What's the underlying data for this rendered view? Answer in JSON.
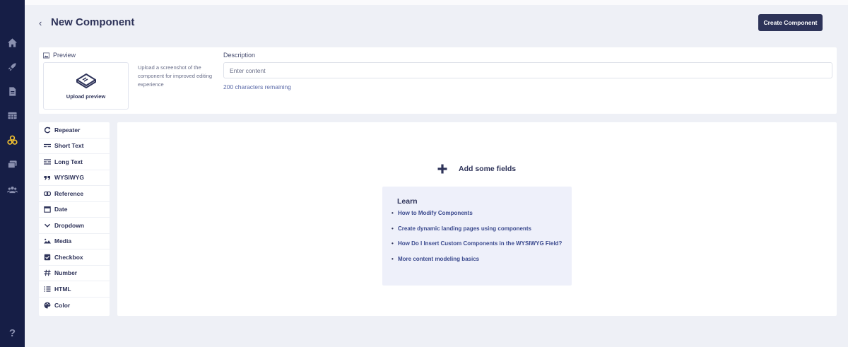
{
  "header": {
    "back_icon": "chevron-left-icon",
    "back_glyph": "‹",
    "title": "New Component",
    "create_label": "Create Component"
  },
  "rail": {
    "icons": [
      "home-icon",
      "rocket-icon",
      "document-icon",
      "table-icon",
      "components-icon",
      "media-icon",
      "users-icon",
      "help-icon"
    ],
    "active": "components-icon",
    "active_color": "#f3c230",
    "icon_color": "#8a90b0",
    "help_glyph": "?"
  },
  "preview": {
    "label": "Preview",
    "upload_label": "Upload preview",
    "help_text": "Upload a screenshot of the component for improved editing experience"
  },
  "description": {
    "label": "Description",
    "placeholder": "Enter content",
    "remaining": "200 characters remaining"
  },
  "field_types": [
    {
      "label": "Repeater",
      "icon": "repeat-icon"
    },
    {
      "label": "Short Text",
      "icon": "short-text-icon"
    },
    {
      "label": "Long Text",
      "icon": "long-text-icon"
    },
    {
      "label": "WYSIWYG",
      "icon": "quote-icon"
    },
    {
      "label": "Reference",
      "icon": "link-icon"
    },
    {
      "label": "Date",
      "icon": "calendar-icon"
    },
    {
      "label": "Dropdown",
      "icon": "chevron-down-icon"
    },
    {
      "label": "Media",
      "icon": "image-icon"
    },
    {
      "label": "Checkbox",
      "icon": "checkbox-icon"
    },
    {
      "label": "Number",
      "icon": "hash-icon"
    },
    {
      "label": "HTML",
      "icon": "list-icon"
    },
    {
      "label": "Color",
      "icon": "palette-icon"
    }
  ],
  "canvas": {
    "add_label": "Add some fields",
    "learn_title": "Learn",
    "learn_links": [
      "How to Modify Components",
      "Create dynamic landing pages using components",
      "How Do I Insert Custom Components in the WYSIWYG Field?",
      "More content modeling basics"
    ]
  },
  "colors": {
    "rail_bg": "#161e46",
    "primary_button": "#2d3358",
    "link": "#3b4a8e",
    "page_bg": "#eef0f6"
  }
}
